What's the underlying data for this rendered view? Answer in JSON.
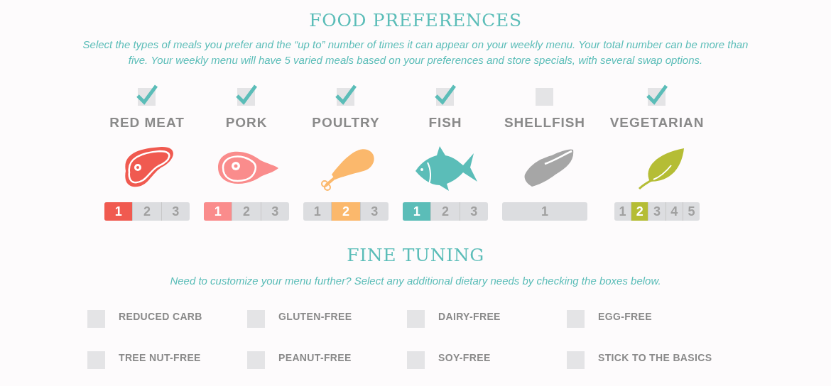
{
  "food_preferences": {
    "title": "FOOD PREFERENCES",
    "intro": "Select the types of meals you prefer and the “up to” number of times it can appear on your weekly menu. Your total number can be more than five. Your weekly menu will have 5 varied meals based on your preferences and store specials, with several swap options.",
    "categories": [
      {
        "label": "RED MEAT",
        "kind": "steak",
        "checked": true,
        "color": "#f05a50",
        "options": [
          {
            "label": "1",
            "selected": true
          },
          {
            "label": "2",
            "selected": false
          },
          {
            "label": "3",
            "selected": false
          }
        ]
      },
      {
        "label": "PORK",
        "kind": "ham",
        "checked": true,
        "color": "#fa8c8c",
        "options": [
          {
            "label": "1",
            "selected": true
          },
          {
            "label": "2",
            "selected": false
          },
          {
            "label": "3",
            "selected": false
          }
        ]
      },
      {
        "label": "POULTRY",
        "kind": "drumstick",
        "checked": true,
        "color": "#fbb86c",
        "options": [
          {
            "label": "1",
            "selected": false
          },
          {
            "label": "2",
            "selected": true
          },
          {
            "label": "3",
            "selected": false
          }
        ]
      },
      {
        "label": "FISH",
        "kind": "fish",
        "checked": true,
        "color": "#5bbdb8",
        "options": [
          {
            "label": "1",
            "selected": true
          },
          {
            "label": "2",
            "selected": false
          },
          {
            "label": "3",
            "selected": false
          }
        ]
      },
      {
        "label": "SHELLFISH",
        "kind": "shellfish",
        "checked": false,
        "color": "#a6a6a6",
        "options": [
          {
            "label": "1",
            "selected": false
          }
        ]
      },
      {
        "label": "VEGETARIAN",
        "kind": "leaf",
        "checked": true,
        "color": "#b5bd35",
        "options": [
          {
            "label": "1",
            "selected": false
          },
          {
            "label": "2",
            "selected": true
          },
          {
            "label": "3",
            "selected": false
          },
          {
            "label": "4",
            "selected": false
          },
          {
            "label": "5",
            "selected": false
          }
        ]
      }
    ]
  },
  "fine_tuning": {
    "title": "FINE TUNING",
    "intro": "Need to customize your menu further? Select any additional dietary needs by checking the boxes below.",
    "options": [
      {
        "label": "REDUCED CARB",
        "checked": false
      },
      {
        "label": "GLUTEN-FREE",
        "checked": false
      },
      {
        "label": "DAIRY-FREE",
        "checked": false
      },
      {
        "label": "EGG-FREE",
        "checked": false
      },
      {
        "label": "TREE NUT-FREE",
        "checked": false
      },
      {
        "label": "PEANUT-FREE",
        "checked": false
      },
      {
        "label": "SOY-FREE",
        "checked": false
      },
      {
        "label": "STICK TO THE BASICS",
        "checked": false
      }
    ]
  }
}
